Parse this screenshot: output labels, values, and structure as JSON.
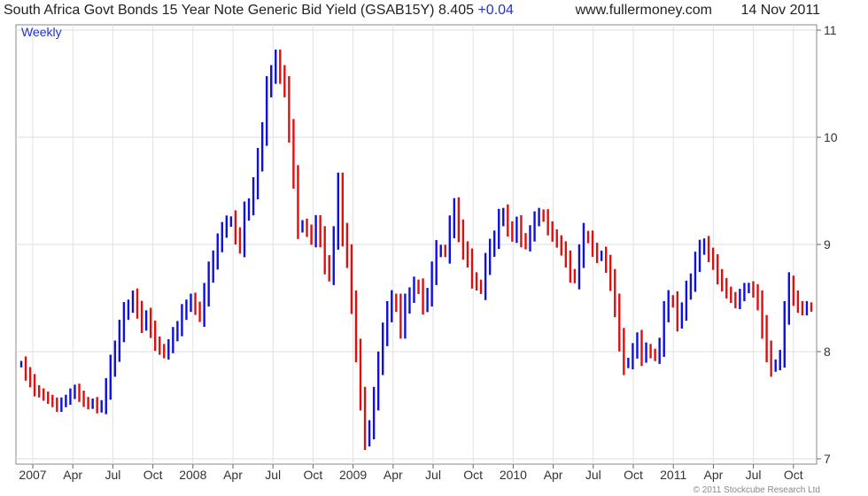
{
  "header": {
    "title": "South Africa Govt Bonds 15 Year Note Generic Bid Yield (GSAB15Y)",
    "last_value": "8.405",
    "change": "+0.04",
    "site": "www.fullermoney.com",
    "date": "14 Nov 2011"
  },
  "chart_data": {
    "type": "bar",
    "title": "South Africa Govt Bonds 15 Year Note Generic Bid Yield (GSAB15Y)",
    "frequency_label": "Weekly",
    "ylim": [
      6.95,
      11.05
    ],
    "y_ticks": [
      7,
      8,
      9,
      10,
      11
    ],
    "x_tick_labels": [
      "2007",
      "Apr",
      "Jul",
      "Oct",
      "2008",
      "Apr",
      "Jul",
      "Oct",
      "2009",
      "Apr",
      "Jul",
      "Oct",
      "2010",
      "Apr",
      "Jul",
      "Oct",
      "2011",
      "Apr",
      "Jul",
      "Oct"
    ],
    "up_color": "#1010dd",
    "down_color": "#dd1010",
    "grid": true,
    "footer": "© 2011 Stockcube Research Ltd",
    "x_start": "2007-01",
    "x_end": "2011-11",
    "series": [
      {
        "name": "GSAB15Y",
        "values": [
          7.88,
          7.79,
          7.72,
          7.64,
          7.61,
          7.58,
          7.55,
          7.52,
          7.48,
          7.52,
          7.55,
          7.6,
          7.64,
          7.58,
          7.53,
          7.5,
          7.52,
          7.47,
          7.5,
          7.65,
          7.85,
          8.0,
          8.18,
          8.35,
          8.42,
          8.5,
          8.38,
          8.25,
          8.32,
          8.2,
          8.08,
          8.02,
          7.98,
          8.05,
          8.15,
          8.22,
          8.35,
          8.42,
          8.48,
          8.4,
          8.33,
          8.52,
          8.72,
          8.85,
          9.0,
          9.12,
          9.2,
          9.22,
          9.08,
          8.98,
          9.28,
          9.36,
          9.52,
          9.78,
          10.02,
          10.45,
          10.58,
          10.72,
          10.58,
          10.45,
          10.05,
          9.62,
          9.15,
          9.18,
          9.12,
          9.05,
          9.18,
          9.05,
          8.82,
          8.72,
          9.05,
          9.55,
          9.08,
          8.88,
          8.45,
          8.0,
          7.55,
          7.18,
          7.28,
          7.55,
          7.88,
          8.15,
          8.35,
          8.48,
          8.42,
          8.22,
          8.42,
          8.52,
          8.62,
          8.58,
          8.43,
          8.52,
          8.72,
          8.92,
          8.95,
          8.92,
          9.15,
          9.32,
          9.12,
          8.95,
          8.85,
          8.68,
          8.62,
          8.58,
          8.8,
          8.95,
          9.05,
          9.22,
          9.28,
          9.15,
          9.08,
          9.18,
          9.05,
          9.0,
          9.1,
          9.22,
          9.28,
          9.25,
          9.15,
          9.08,
          9.02,
          8.95,
          8.85,
          8.72,
          8.68,
          8.88,
          9.08,
          9.05,
          8.95,
          8.88,
          8.9,
          8.8,
          8.65,
          8.42,
          8.1,
          7.88,
          7.9,
          8.0,
          8.1,
          7.95,
          8.02,
          7.98,
          7.95,
          8.05,
          8.35,
          8.48,
          8.45,
          8.28,
          8.38,
          8.55,
          8.65,
          8.82,
          8.95,
          9.0,
          8.9,
          8.82,
          8.7,
          8.62,
          8.55,
          8.5,
          8.45,
          8.52,
          8.58,
          8.6,
          8.55,
          8.45,
          8.22,
          8.0,
          7.85,
          7.88,
          7.95,
          8.35,
          8.62,
          8.5,
          8.42,
          8.38,
          8.42,
          8.405
        ]
      }
    ]
  }
}
